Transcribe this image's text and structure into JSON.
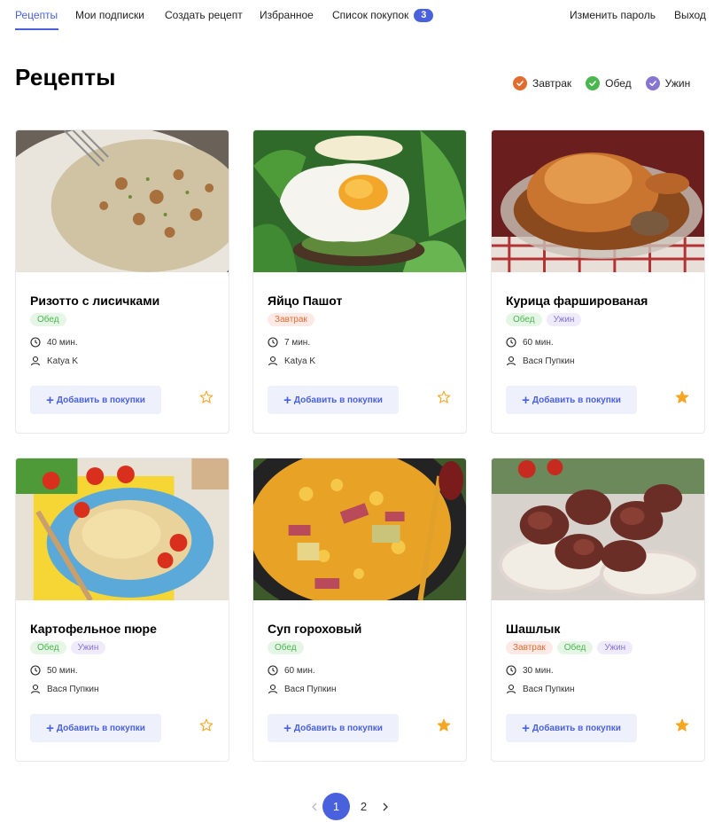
{
  "colors": {
    "accent": "#4a61dd",
    "breakfast": "#e26c2d",
    "lunch": "#49b64e",
    "dinner": "#8775d2",
    "star": "#f5a623"
  },
  "nav": {
    "items": [
      {
        "label": "Рецепты",
        "active": true
      },
      {
        "label": "Мои подписки"
      },
      {
        "label": "Создать рецепт"
      },
      {
        "label": "Избранное"
      },
      {
        "label": "Список покупок"
      }
    ],
    "cart_count": "3",
    "change_password": "Изменить пароль",
    "logout": "Выход"
  },
  "page_title": "Рецепты",
  "filters": [
    {
      "label": "Завтрак",
      "icon": "check-icon",
      "color": "#e26c2d"
    },
    {
      "label": "Обед",
      "icon": "check-icon",
      "color": "#49b64e"
    },
    {
      "label": "Ужин",
      "icon": "check-icon",
      "color": "#8775d2"
    }
  ],
  "add_to_cart_label": "Добавить в покупки",
  "recipes": [
    {
      "title": "Ризотто с лисичками",
      "tags": [
        "Обед"
      ],
      "time": "40 мин.",
      "author": "Katya K",
      "favorite": false
    },
    {
      "title": "Яйцо Пашот",
      "tags": [
        "Завтрак"
      ],
      "time": "7 мин.",
      "author": "Katya K",
      "favorite": false
    },
    {
      "title": "Курица фаршированая",
      "tags": [
        "Обед",
        "Ужин"
      ],
      "time": "60 мин.",
      "author": "Вася Пупкин",
      "favorite": true
    },
    {
      "title": "Картофельное пюре",
      "tags": [
        "Обед",
        "Ужин"
      ],
      "time": "50 мин.",
      "author": "Вася Пупкин",
      "favorite": false
    },
    {
      "title": "Суп гороховый",
      "tags": [
        "Обед"
      ],
      "time": "60 мин.",
      "author": "Вася Пупкин",
      "favorite": true
    },
    {
      "title": "Шашлык",
      "tags": [
        "Завтрак",
        "Обед",
        "Ужин"
      ],
      "time": "30 мин.",
      "author": "Вася Пупкин",
      "favorite": true
    }
  ],
  "pagination": {
    "pages": [
      "1",
      "2"
    ],
    "current": "1"
  }
}
